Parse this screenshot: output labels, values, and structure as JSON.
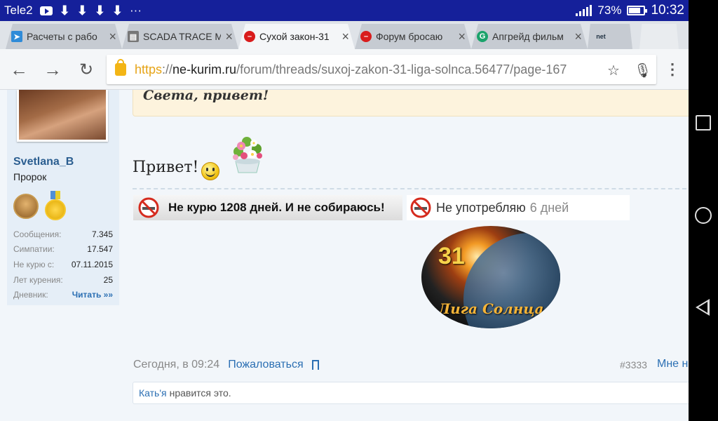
{
  "status_bar": {
    "carrier": "Tele2",
    "battery": "73%",
    "time": "10:32",
    "icons": [
      "youtube-icon",
      "download-icon",
      "download-icon",
      "download-icon",
      "download-icon",
      "more-notifications-icon",
      "signal-h-icon",
      "battery-icon"
    ]
  },
  "tabs": [
    {
      "title": "Расчеты с рабо",
      "icon": "telegram-icon",
      "color": "#2f8bd8",
      "active": false
    },
    {
      "title": "SCADA TRACE M",
      "icon": "page-icon",
      "color": "#777777",
      "active": false
    },
    {
      "title": "Сухой закон-31",
      "icon": "no-entry-icon",
      "color": "#d91c1c",
      "active": true
    },
    {
      "title": "Форум бросаю",
      "icon": "no-entry-icon",
      "color": "#d91c1c",
      "active": false
    },
    {
      "title": "Апгрейд фильм",
      "icon": "g-logo-icon",
      "color": "#1aa36b",
      "active": false
    }
  ],
  "extra_tab_icon_label": "net",
  "omnibox": {
    "scheme": "https",
    "separator": "://",
    "host": "ne-kurim.ru",
    "path": "/forum/threads/suxoj-zakon-31-liga-solnca.56477/page-167"
  },
  "user": {
    "name": "Svetlana_B",
    "title": "Пророк",
    "stats": [
      {
        "label": "Сообщения:",
        "value": "7.345"
      },
      {
        "label": "Симпатии:",
        "value": "17.547"
      },
      {
        "label": "Не курю с:",
        "value": "07.11.2015"
      },
      {
        "label": "Лет курения:",
        "value": "25"
      },
      {
        "label": "Дневник:",
        "value": "Читать »»",
        "link": true
      }
    ]
  },
  "post": {
    "quote_text": "Света, привет!",
    "message": "Привет!",
    "banner_no_smoking": "Не курю 1208 дней. И не собираюсь!",
    "banner_no_use": "Не употребляю",
    "banner_no_use_days": "6 дней",
    "logo_number": "31",
    "logo_text": "Лига Солнца",
    "date": "Сегодня, в 09:24",
    "report_label": "Пожаловаться",
    "post_number": "#3333",
    "like_label": "Мне нравится",
    "likes_user": "Кать'я",
    "likes_suffix": "нравится это."
  }
}
